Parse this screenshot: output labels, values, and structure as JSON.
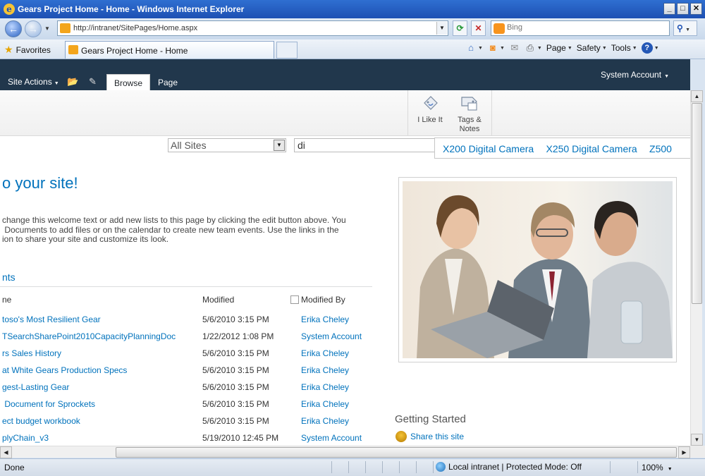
{
  "window": {
    "title": "Gears Project Home - Home - Windows Internet Explorer",
    "minimize": "_",
    "maximize": "□",
    "close": "✕"
  },
  "addressbar": {
    "url": "http://intranet/SitePages/Home.aspx",
    "search_placeholder": "Bing"
  },
  "favbar": {
    "favorites_label": "Favorites",
    "tab_title": "Gears Project Home - Home",
    "commands": [
      "Page",
      "Safety",
      "Tools"
    ]
  },
  "sharepoint": {
    "site_actions": "Site Actions",
    "tabs": [
      "Browse",
      "Page"
    ],
    "active_tab": "Browse",
    "user": "System Account",
    "ribbon": {
      "i_like_it": "I Like It",
      "tags_notes_line1": "Tags &",
      "tags_notes_line2": "Notes"
    },
    "search": {
      "scope": "All Sites",
      "query": "di",
      "suggestions": [
        "X200 Digital Camera",
        "X250 Digital Camera",
        "Z500"
      ]
    }
  },
  "welcome": {
    "title": "o your site!",
    "lines": [
      "change this welcome text or add new lists to this page by clicking the edit button above. You",
      " Documents to add files or on the calendar to create new team events. Use the links in the",
      "ion to share your site and customize its look."
    ]
  },
  "documents": {
    "title": "nts",
    "columns": {
      "name": "ne",
      "modified": "Modified",
      "modified_by": "Modified By"
    },
    "rows": [
      {
        "name": "toso's Most Resilient Gear",
        "modified": "5/6/2010 3:15 PM",
        "by": "Erika Cheley"
      },
      {
        "name": "TSearchSharePoint2010CapacityPlanningDoc",
        "modified": "1/22/2012 1:08 PM",
        "by": "System Account"
      },
      {
        "name": "rs Sales History",
        "modified": "5/6/2010 3:15 PM",
        "by": "Erika Cheley"
      },
      {
        "name": "at White Gears Production Specs",
        "modified": "5/6/2010 3:15 PM",
        "by": "Erika Cheley"
      },
      {
        "name": "gest-Lasting Gear",
        "modified": "5/6/2010 3:15 PM",
        "by": "Erika Cheley"
      },
      {
        "name": " Document for Sprockets",
        "modified": "5/6/2010 3:15 PM",
        "by": "Erika Cheley"
      },
      {
        "name": "ect budget workbook",
        "modified": "5/6/2010 3:15 PM",
        "by": "Erika Cheley"
      },
      {
        "name": "plyChain_v3",
        "modified": "5/19/2010 12:45 PM",
        "by": "System Account"
      }
    ]
  },
  "getting_started": {
    "title": "Getting Started",
    "items": [
      "Share this site"
    ]
  },
  "status": {
    "text": "Done",
    "zone": "Local intranet | Protected Mode: Off",
    "zoom": "100%"
  },
  "colors": {
    "sp_topbar": "#21374c",
    "link_blue": "#0072bc",
    "ie_titlebar": "#2f6fd1"
  },
  "icons": [
    "ie-logo-icon",
    "back-icon",
    "forward-icon",
    "refresh-icon",
    "stop-icon",
    "bing-icon",
    "search-icon",
    "favorites-star-icon",
    "home-icon",
    "rss-icon",
    "mail-icon",
    "print-icon",
    "help-icon",
    "globe-icon",
    "thumbs-up-icon",
    "tag-icon"
  ]
}
